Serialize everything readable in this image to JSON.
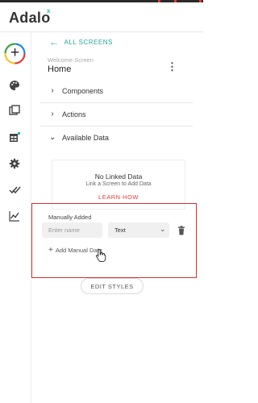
{
  "app": {
    "logo_text": "Adalo",
    "logo_mark": "x"
  },
  "nav": {
    "items": [
      {
        "id": "add",
        "icon": "plus-icon"
      },
      {
        "id": "branding",
        "icon": "palette-icon"
      },
      {
        "id": "screens",
        "icon": "screens-icon"
      },
      {
        "id": "database",
        "icon": "database-icon"
      },
      {
        "id": "settings",
        "icon": "gear-icon"
      },
      {
        "id": "publish",
        "icon": "double-check-icon"
      },
      {
        "id": "analytics",
        "icon": "analytics-icon"
      }
    ]
  },
  "panel": {
    "back_label": "ALL SCREENS",
    "screen_subtitle": "Welcome Screen",
    "screen_title": "Home",
    "sections": {
      "components": "Components",
      "actions": "Actions",
      "available_data": "Available Data"
    },
    "no_linked": {
      "title": "No Linked Data",
      "subtitle": "Link a Screen to Add Data",
      "learn_how": "LEARN HOW"
    },
    "manual": {
      "label": "Manually Added",
      "name_placeholder": "Enter name",
      "type_value": "Text",
      "add_label": "Add Manual Data"
    },
    "edit_styles": "EDIT STYLES"
  },
  "colors": {
    "accent": "#26a69a",
    "danger": "#e53935",
    "highlight_border": "#d32f2f"
  }
}
